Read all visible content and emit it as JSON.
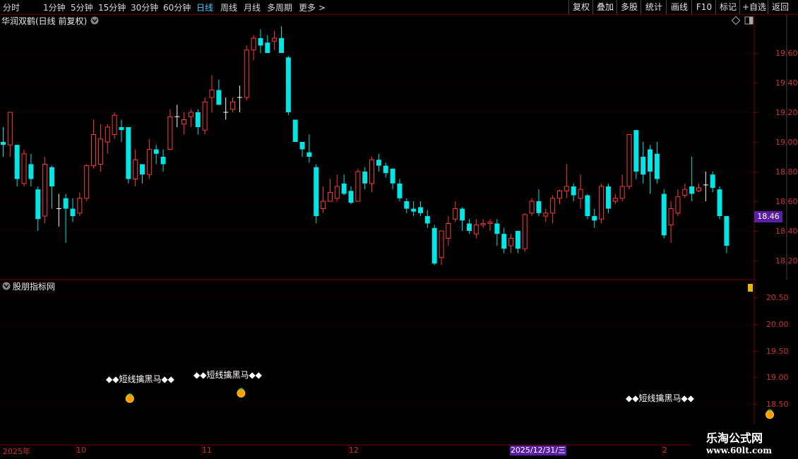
{
  "toolbar": {
    "periods": [
      "分时",
      "1分钟",
      "5分钟",
      "15分钟",
      "30分钟",
      "60分钟",
      "日线",
      "周线",
      "月线",
      "多周期",
      "更多 >"
    ],
    "active_period": "日线",
    "right": [
      "复权",
      "叠加",
      "多股",
      "统计",
      "画线",
      "F10",
      "标记",
      "+自选",
      "返回"
    ]
  },
  "main_panel": {
    "title": "华润双鹤(日线 前复权)",
    "y_labels": [
      "19.60",
      "19.40",
      "19.20",
      "19.00",
      "18.80",
      "18.60",
      "18.40",
      "18.20"
    ],
    "last_price": "18.46"
  },
  "indicator_panel": {
    "title": "股朋指标网",
    "y_labels": [
      "20.50",
      "20.00",
      "19.50",
      "19.00",
      "18.50"
    ],
    "signal_text": "◆◆短线擒黑马◆◆"
  },
  "x_axis": {
    "labels": [
      "2025年",
      "10",
      "11",
      "12",
      "2"
    ],
    "cursor_date": "2025/12/31/三"
  },
  "logo": {
    "line1": "乐淘公式网",
    "line2": "www.60lt.com"
  },
  "colors": {
    "up": "#ff3a3a",
    "down": "#00e5e5",
    "axis": "#7a0000",
    "grid": "#3a0000",
    "badge": "#5b1fa3"
  },
  "chart_data": {
    "type": "candlestick",
    "ylim": [
      18.1,
      19.75
    ],
    "candles": [
      [
        19.0,
        18.98,
        19.1,
        18.9
      ],
      [
        18.98,
        19.2,
        19.2,
        18.9
      ],
      [
        18.98,
        18.75,
        18.98,
        18.7
      ],
      [
        18.72,
        18.92,
        18.95,
        18.7
      ],
      [
        18.85,
        18.75,
        18.92,
        18.7
      ],
      [
        18.68,
        18.48,
        18.7,
        18.4
      ],
      [
        18.5,
        18.85,
        18.9,
        18.45
      ],
      [
        18.83,
        18.7,
        18.84,
        18.55
      ],
      [
        18.55,
        18.55,
        18.65,
        18.43
      ],
      [
        18.62,
        18.55,
        18.65,
        18.32
      ],
      [
        18.55,
        18.5,
        18.62,
        18.46
      ],
      [
        18.52,
        18.62,
        18.66,
        18.5
      ],
      [
        18.62,
        18.84,
        18.85,
        18.6
      ],
      [
        18.84,
        19.05,
        19.15,
        18.82
      ],
      [
        18.85,
        19.02,
        19.12,
        18.8
      ],
      [
        19.0,
        19.1,
        19.12,
        18.92
      ],
      [
        19.05,
        19.18,
        19.2,
        19.02
      ],
      [
        19.1,
        19.08,
        19.15,
        19.0
      ],
      [
        19.1,
        18.75,
        19.1,
        18.72
      ],
      [
        18.75,
        18.88,
        18.95,
        18.7
      ],
      [
        18.85,
        18.78,
        18.85,
        18.72
      ],
      [
        18.78,
        18.95,
        19.02,
        18.75
      ],
      [
        18.95,
        18.92,
        18.98,
        18.85
      ],
      [
        18.9,
        18.85,
        18.95,
        18.8
      ],
      [
        18.95,
        19.17,
        19.22,
        18.95
      ],
      [
        19.17,
        19.17,
        19.25,
        19.1
      ],
      [
        19.12,
        19.15,
        19.2,
        19.05
      ],
      [
        19.17,
        19.2,
        19.22,
        19.1
      ],
      [
        19.2,
        19.1,
        19.22,
        19.05
      ],
      [
        19.08,
        19.27,
        19.3,
        19.05
      ],
      [
        19.3,
        19.35,
        19.45,
        19.2
      ],
      [
        19.35,
        19.25,
        19.42,
        19.25
      ],
      [
        19.2,
        19.2,
        19.3,
        19.15
      ],
      [
        19.22,
        19.27,
        19.3,
        19.2
      ],
      [
        19.3,
        19.3,
        19.38,
        19.2
      ],
      [
        19.3,
        19.62,
        19.65,
        19.28
      ],
      [
        19.62,
        19.7,
        19.72,
        19.55
      ],
      [
        19.7,
        19.65,
        19.76,
        19.6
      ],
      [
        19.67,
        19.6,
        19.72,
        19.6
      ],
      [
        19.68,
        19.7,
        19.75,
        19.62
      ],
      [
        19.7,
        19.6,
        19.78,
        19.6
      ],
      [
        19.57,
        19.2,
        19.58,
        19.18
      ],
      [
        19.15,
        19.0,
        19.15,
        19.0
      ],
      [
        19.0,
        18.95,
        19.0,
        18.9
      ],
      [
        18.93,
        18.9,
        19.05,
        18.86
      ],
      [
        18.83,
        18.5,
        18.85,
        18.45
      ],
      [
        18.55,
        18.6,
        18.7,
        18.52
      ],
      [
        18.6,
        18.66,
        18.75,
        18.6
      ],
      [
        18.62,
        18.7,
        18.78,
        18.6
      ],
      [
        18.72,
        18.65,
        18.78,
        18.64
      ],
      [
        18.67,
        18.59,
        18.7,
        18.58
      ],
      [
        18.6,
        18.8,
        18.82,
        18.6
      ],
      [
        18.8,
        18.72,
        18.83,
        18.68
      ],
      [
        18.72,
        18.88,
        18.9,
        18.66
      ],
      [
        18.88,
        18.84,
        18.92,
        18.8
      ],
      [
        18.84,
        18.79,
        18.86,
        18.76
      ],
      [
        18.82,
        18.72,
        18.82,
        18.68
      ],
      [
        18.72,
        18.62,
        18.75,
        18.6
      ],
      [
        18.6,
        18.55,
        18.62,
        18.52
      ],
      [
        18.55,
        18.53,
        18.6,
        18.5
      ],
      [
        18.56,
        18.52,
        18.6,
        18.5
      ],
      [
        18.5,
        18.45,
        18.54,
        18.42
      ],
      [
        18.42,
        18.18,
        18.44,
        18.17
      ],
      [
        18.22,
        18.4,
        18.4,
        18.17
      ],
      [
        18.35,
        18.45,
        18.5,
        18.3
      ],
      [
        18.48,
        18.55,
        18.6,
        18.46
      ],
      [
        18.55,
        18.47,
        18.56,
        18.4
      ],
      [
        18.45,
        18.4,
        18.48,
        18.38
      ],
      [
        18.38,
        18.44,
        18.48,
        18.35
      ],
      [
        18.44,
        18.45,
        18.48,
        18.42
      ],
      [
        18.45,
        18.46,
        18.48,
        18.4
      ],
      [
        18.45,
        18.38,
        18.48,
        18.3
      ],
      [
        18.38,
        18.28,
        18.42,
        18.25
      ],
      [
        18.3,
        18.35,
        18.38,
        18.25
      ],
      [
        18.4,
        18.28,
        18.4,
        18.25
      ],
      [
        18.28,
        18.51,
        18.52,
        18.26
      ],
      [
        18.52,
        18.6,
        18.62,
        18.5
      ],
      [
        18.6,
        18.52,
        18.68,
        18.5
      ],
      [
        18.5,
        18.52,
        18.55,
        18.46
      ],
      [
        18.52,
        18.62,
        18.64,
        18.45
      ],
      [
        18.62,
        18.67,
        18.68,
        18.58
      ],
      [
        18.67,
        18.7,
        18.85,
        18.62
      ],
      [
        18.7,
        18.64,
        18.72,
        18.6
      ],
      [
        18.62,
        18.68,
        18.78,
        18.55
      ],
      [
        18.64,
        18.5,
        18.65,
        18.48
      ],
      [
        18.5,
        18.47,
        18.55,
        18.42
      ],
      [
        18.48,
        18.7,
        18.72,
        18.45
      ],
      [
        18.7,
        18.55,
        18.72,
        18.52
      ],
      [
        18.6,
        18.62,
        18.65,
        18.58
      ],
      [
        18.62,
        18.7,
        18.78,
        18.6
      ],
      [
        18.7,
        19.05,
        19.05,
        18.68
      ],
      [
        19.08,
        18.8,
        19.08,
        18.75
      ],
      [
        18.9,
        18.78,
        19.0,
        18.72
      ],
      [
        18.95,
        18.8,
        18.98,
        18.65
      ],
      [
        18.92,
        18.75,
        19.0,
        18.72
      ],
      [
        18.65,
        18.37,
        18.68,
        18.35
      ],
      [
        18.44,
        18.55,
        18.6,
        18.32
      ],
      [
        18.52,
        18.63,
        18.68,
        18.5
      ],
      [
        18.64,
        18.68,
        18.72,
        18.62
      ],
      [
        18.7,
        18.65,
        18.9,
        18.6
      ],
      [
        18.67,
        18.69,
        18.72,
        18.66
      ],
      [
        18.71,
        18.71,
        18.8,
        18.6
      ],
      [
        18.78,
        18.69,
        18.8,
        18.66
      ],
      [
        18.68,
        18.5,
        18.7,
        18.48
      ],
      [
        18.5,
        18.3,
        18.5,
        18.25
      ]
    ],
    "signals": [
      {
        "candle": 18,
        "label_value": 19.0,
        "marker_value": 18.6
      },
      {
        "candle": 34,
        "label_value": 19.08,
        "marker_value": 18.7
      },
      {
        "candle": 110,
        "label_value": 18.82,
        "marker_value": 18.3
      }
    ]
  }
}
